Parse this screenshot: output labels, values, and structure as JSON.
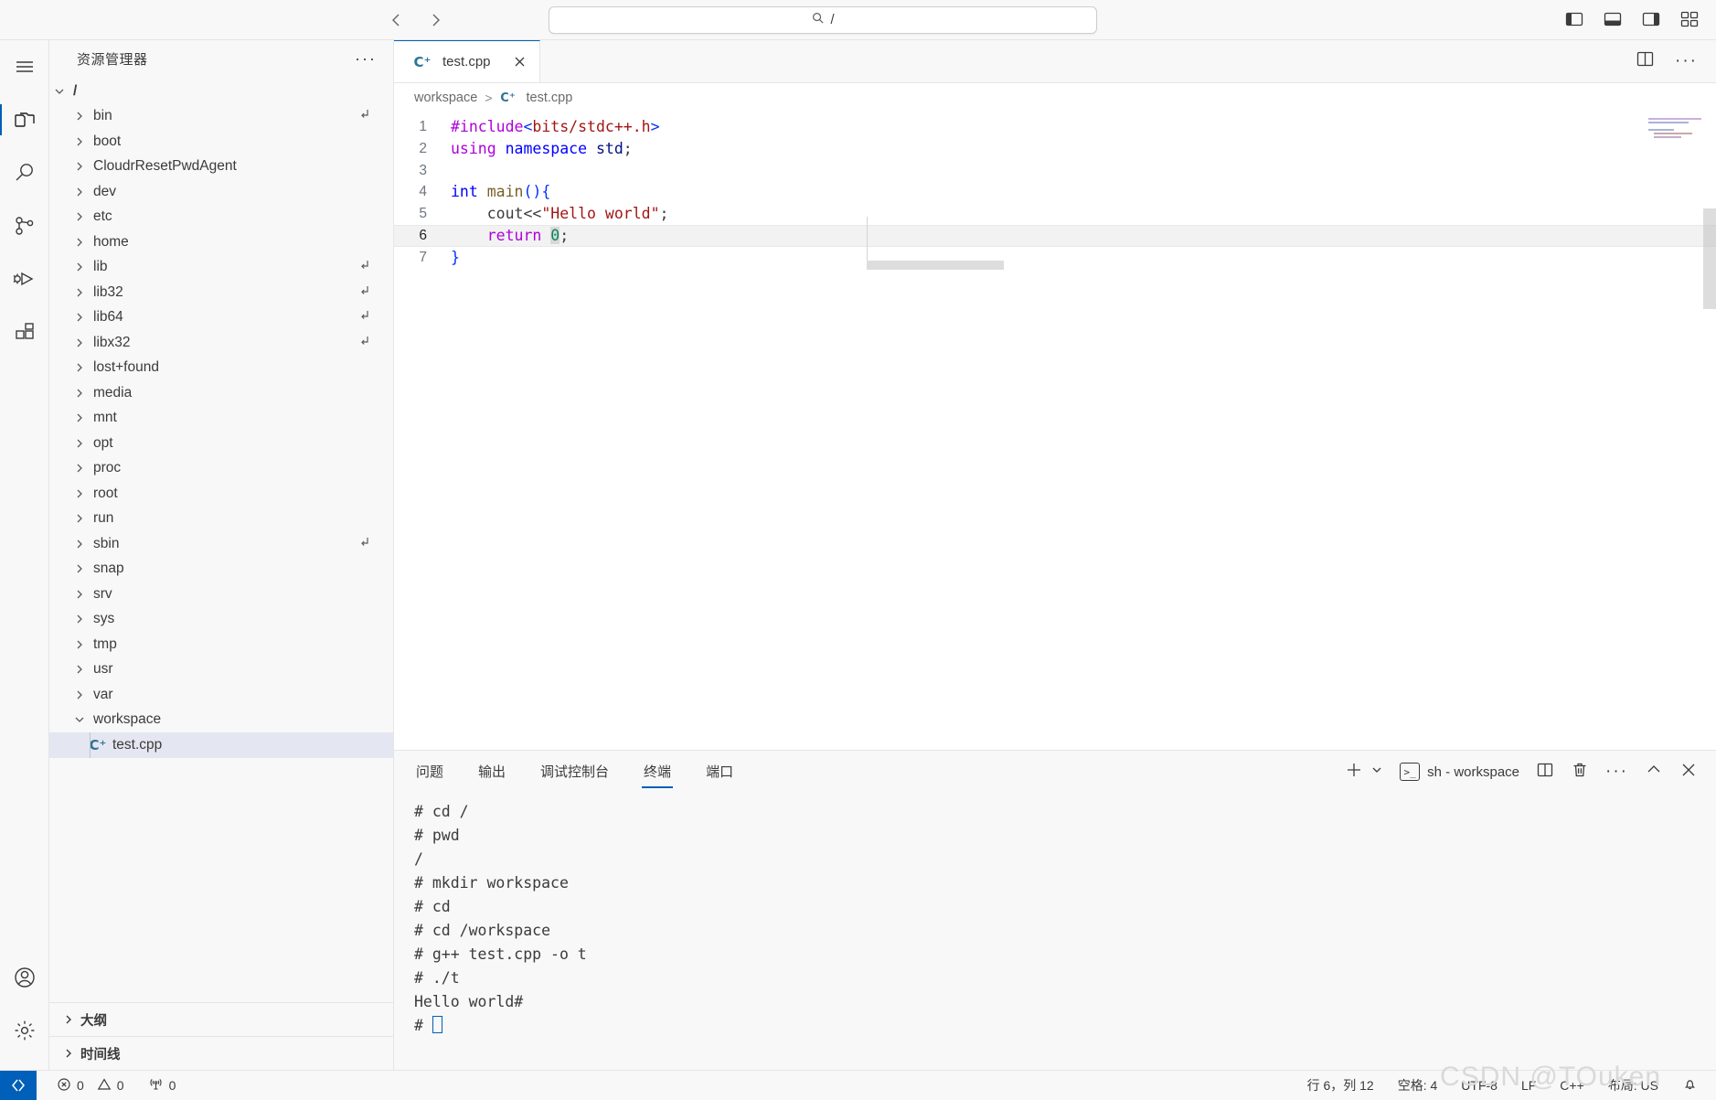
{
  "titlebar": {
    "back_icon": "arrow-left-icon",
    "forward_icon": "arrow-right-icon",
    "command_center_text": "/",
    "search_icon": "search-icon",
    "layout_icons": [
      "toggle-primary-sidebar-icon",
      "toggle-panel-icon",
      "toggle-secondary-sidebar-icon",
      "customize-layout-icon"
    ]
  },
  "activitybar": {
    "items": [
      {
        "name": "menu",
        "icon": "hamburger-menu-icon",
        "active": false
      },
      {
        "name": "explorer",
        "icon": "files-icon",
        "active": true
      },
      {
        "name": "search",
        "icon": "search-icon",
        "active": false
      },
      {
        "name": "source-control",
        "icon": "source-control-icon",
        "active": false
      },
      {
        "name": "run-and-debug",
        "icon": "run-and-debug-icon",
        "active": false
      },
      {
        "name": "extensions",
        "icon": "extensions-icon",
        "active": false
      }
    ],
    "bottom_items": [
      {
        "name": "accounts",
        "icon": "account-icon"
      },
      {
        "name": "settings",
        "icon": "gear-icon"
      }
    ]
  },
  "sidebar": {
    "title": "资源管理器",
    "more_actions": "···",
    "root": {
      "label": "/",
      "expanded": true
    },
    "items": [
      {
        "label": "bin",
        "expanded": false,
        "symlink": true
      },
      {
        "label": "boot",
        "expanded": false,
        "symlink": false
      },
      {
        "label": "CloudrResetPwdAgent",
        "expanded": false,
        "symlink": false
      },
      {
        "label": "dev",
        "expanded": false,
        "symlink": false
      },
      {
        "label": "etc",
        "expanded": false,
        "symlink": false
      },
      {
        "label": "home",
        "expanded": false,
        "symlink": false
      },
      {
        "label": "lib",
        "expanded": false,
        "symlink": true
      },
      {
        "label": "lib32",
        "expanded": false,
        "symlink": true
      },
      {
        "label": "lib64",
        "expanded": false,
        "symlink": true
      },
      {
        "label": "libx32",
        "expanded": false,
        "symlink": true
      },
      {
        "label": "lost+found",
        "expanded": false,
        "symlink": false
      },
      {
        "label": "media",
        "expanded": false,
        "symlink": false
      },
      {
        "label": "mnt",
        "expanded": false,
        "symlink": false
      },
      {
        "label": "opt",
        "expanded": false,
        "symlink": false
      },
      {
        "label": "proc",
        "expanded": false,
        "symlink": false
      },
      {
        "label": "root",
        "expanded": false,
        "symlink": false
      },
      {
        "label": "run",
        "expanded": false,
        "symlink": false
      },
      {
        "label": "sbin",
        "expanded": false,
        "symlink": true
      },
      {
        "label": "snap",
        "expanded": false,
        "symlink": false
      },
      {
        "label": "srv",
        "expanded": false,
        "symlink": false
      },
      {
        "label": "sys",
        "expanded": false,
        "symlink": false
      },
      {
        "label": "tmp",
        "expanded": false,
        "symlink": false
      },
      {
        "label": "usr",
        "expanded": false,
        "symlink": false
      },
      {
        "label": "var",
        "expanded": false,
        "symlink": false
      },
      {
        "label": "workspace",
        "expanded": true,
        "symlink": false
      }
    ],
    "selected_file": {
      "label": "test.cpp",
      "icon": "cpp-file-icon"
    },
    "sections": [
      {
        "label": "大纲",
        "expanded": false
      },
      {
        "label": "时间线",
        "expanded": false
      }
    ]
  },
  "editor": {
    "tab": {
      "label": "test.cpp",
      "icon": "cpp-file-icon",
      "close_icon": "close-icon",
      "active": true
    },
    "tab_actions": [
      "split-editor-icon",
      "more-actions-icon"
    ],
    "breadcrumb": {
      "folder": "workspace",
      "separator": ">",
      "file": "test.cpp",
      "file_icon": "cpp-file-icon"
    },
    "lines": [
      {
        "n": "1",
        "current": false
      },
      {
        "n": "2",
        "current": false
      },
      {
        "n": "3",
        "current": false
      },
      {
        "n": "4",
        "current": false
      },
      {
        "n": "5",
        "current": false
      },
      {
        "n": "6",
        "current": true
      },
      {
        "n": "7",
        "current": false
      }
    ],
    "source_text": [
      "#include<bits/stdc++.h>",
      "using namespace std;",
      "",
      "int main(){",
      "    cout<<\"Hello world\";",
      "    return 0;",
      "}"
    ]
  },
  "panel": {
    "tabs": [
      {
        "label": "问题",
        "active": false
      },
      {
        "label": "输出",
        "active": false
      },
      {
        "label": "调试控制台",
        "active": false
      },
      {
        "label": "终端",
        "active": true
      },
      {
        "label": "端口",
        "active": false
      }
    ],
    "actions": {
      "new_terminal_icon": "plus-icon",
      "new_terminal_dropdown_icon": "chevron-down-icon",
      "terminal_name": "sh - workspace",
      "terminal_icon": ">_",
      "split_icon": "split-terminal-icon",
      "kill_icon": "trash-icon",
      "more_icon": "more-actions-icon",
      "maximize_icon": "chevron-up-icon",
      "close_icon": "close-icon"
    },
    "terminal_lines": [
      "# cd /",
      "# pwd",
      "/",
      "# mkdir workspace",
      "# cd",
      "# cd /workspace",
      "# g++ test.cpp -o t",
      "# ./t",
      "Hello world#",
      "# "
    ]
  },
  "statusbar": {
    "remote_icon": "remote-window-icon",
    "errors_icon": "error-icon",
    "errors_count": "0",
    "warnings_icon": "warning-icon",
    "warnings_count": "0",
    "ports_icon": "radio-tower-icon",
    "ports_count": "0",
    "cursor_position": "行 6，列 12",
    "indentation": "空格: 4",
    "encoding": "UTF-8",
    "eol": "LF",
    "language": "C++",
    "keyboard_layout": "布局: US",
    "bell_icon": "bell-icon"
  },
  "watermark": "CSDN @TOuken",
  "colors": {
    "accent": "#005fb8",
    "selection": "#e4e6f1",
    "chrome": "#f8f8f8",
    "editor_bg": "#ffffff",
    "border": "#e5e5e5"
  }
}
